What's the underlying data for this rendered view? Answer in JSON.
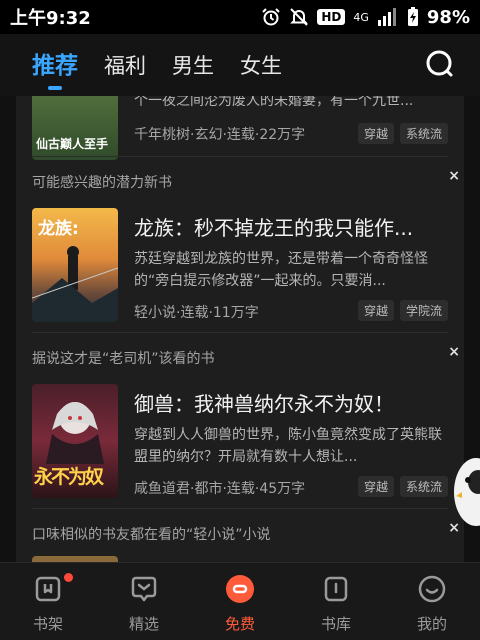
{
  "status_bar": {
    "time": "上午9:32",
    "hd": "HD",
    "network": "4G",
    "battery": "98%"
  },
  "top_nav": {
    "tabs": [
      {
        "label": "推荐",
        "active": true
      },
      {
        "label": "福利",
        "active": false
      },
      {
        "label": "男生",
        "active": false
      },
      {
        "label": "女生",
        "active": false
      }
    ]
  },
  "feed": {
    "partial_book": {
      "cover_text": "仙古巅人至手",
      "desc_line": "个一夜之间沦为废人的未婚妻，有一个九世...",
      "meta": "千年桃树·玄幻·连载·22万字",
      "tags": [
        "穿越",
        "系统流"
      ]
    },
    "sections": [
      {
        "header": "可能感兴趣的潜力新书",
        "close": "×",
        "book": {
          "cover_text": "龙族:",
          "title": "龙族：秒不掉龙王的我只能作...",
          "desc": "苏廷穿越到龙族的世界，还是带着一个奇奇怪怪的“旁白提示修改器”一起来的。只要消...",
          "meta": "轻小说·连载·11万字",
          "tags": [
            "穿越",
            "学院流"
          ]
        }
      },
      {
        "header": "据说这才是“老司机”该看的书",
        "close": "×",
        "book": {
          "cover_text": "永不为奴",
          "title": "御兽：我神兽纳尔永不为奴！",
          "desc": "穿越到人人御兽的世界，陈小鱼竟然变成了英熊联盟里的纳尔？开局就有数十人想让...",
          "meta": "咸鱼道君·都市·连载·45万字",
          "tags": [
            "穿越",
            "系统流"
          ]
        }
      },
      {
        "header": "口味相似的书友都在看的“轻小说”小说",
        "close": "×"
      }
    ]
  },
  "bottom_nav": {
    "items": [
      {
        "label": "书架",
        "icon": "bookshelf-icon",
        "active": false,
        "dot": true
      },
      {
        "label": "精选",
        "icon": "heart-chat-icon",
        "active": false
      },
      {
        "label": "免费",
        "icon": "free-coin-icon",
        "active": true
      },
      {
        "label": "书库",
        "icon": "library-icon",
        "active": false
      },
      {
        "label": "我的",
        "icon": "profile-smile-icon",
        "active": false
      }
    ]
  },
  "colors": {
    "accent_blue": "#3aa6ff",
    "accent_orange": "#ff5b3a",
    "background": "#1e1e1e"
  }
}
